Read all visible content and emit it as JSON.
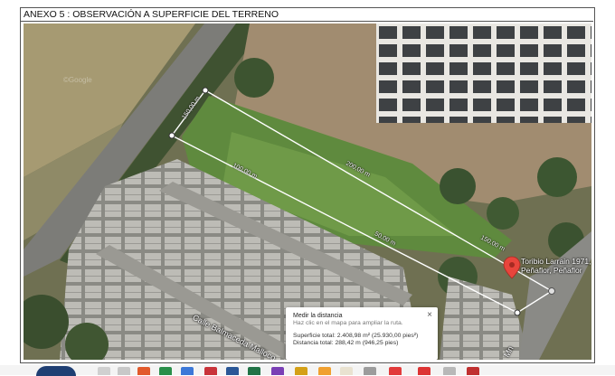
{
  "header": {
    "title": "ANEXO 5 : OBSERVACIÓN A SUPERFICIE DEL TERRENO"
  },
  "map": {
    "watermark": "©Google",
    "measurements": [
      "150,00 m",
      "100,00 m",
      "200,00 m",
      "50,00 m",
      "150,00 m"
    ],
    "street_label": "Calle Balmaceda Malloco",
    "street_label_2": "Mn",
    "pin_label_1": "Toribio Larrain 1971,",
    "pin_label_2": "Peñaflor, Peñaflor",
    "pin_color": "#e8453c",
    "polygon_color": "#ffffff"
  },
  "popup": {
    "title": "Medir la distancia",
    "hint": "Haz clic en el mapa para ampliar la ruta.",
    "area": "Superficie total: 2.408,98 m² (25.930,00 pies²)",
    "distance": "Distancia total: 288,42 m (946,25 pies)",
    "close": "×"
  },
  "taskbar": {
    "icons": [
      "globe-icon",
      "file-explorer-icon",
      "store-icon",
      "mail-icon",
      "calendar-icon",
      "chrome-icon",
      "acrobat-icon",
      "word-icon",
      "excel-icon",
      "photos-icon",
      "teams-icon",
      "settings-icon"
    ]
  }
}
